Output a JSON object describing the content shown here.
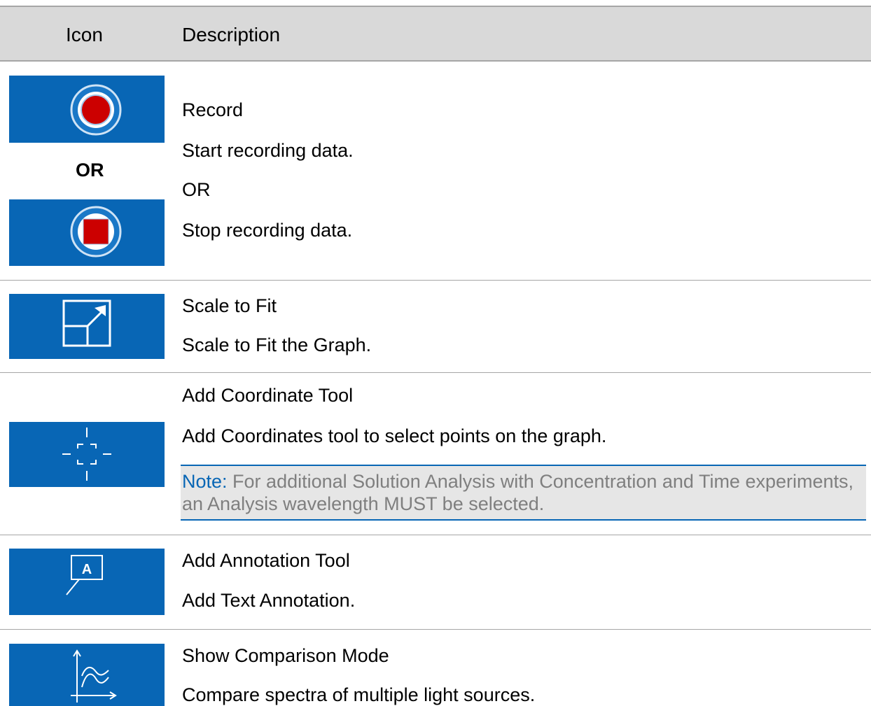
{
  "header": {
    "icon_col": "Icon",
    "desc_col": "Description"
  },
  "colors": {
    "icon_bg": "#0866b5",
    "record_red": "#cc0000",
    "header_bg": "#d9d9d9",
    "note_accent": "#0866b5"
  },
  "rows": [
    {
      "icons": [
        "record-icon",
        "stop-icon"
      ],
      "icon_separator": "OR",
      "title": "Record",
      "lines": [
        "Start recording data.",
        "OR",
        "Stop recording data."
      ]
    },
    {
      "icons": [
        "scale-to-fit-icon"
      ],
      "title": "Scale to Fit",
      "lines": [
        "Scale to Fit the Graph."
      ]
    },
    {
      "icons": [
        "coordinate-tool-icon"
      ],
      "title": "Add Coordinate Tool",
      "lines": [
        "Add Coordinates tool to select points on the graph."
      ],
      "note": {
        "label": "Note:",
        "text": " For additional Solution Analysis with Concentration and Time experiments, an Analysis wavelength MUST be selected."
      }
    },
    {
      "icons": [
        "annotation-tool-icon"
      ],
      "title": "Add Annotation Tool",
      "lines": [
        "Add Text Annotation."
      ],
      "icon_letter": "A"
    },
    {
      "icons": [
        "comparison-mode-icon"
      ],
      "title": "Show Comparison Mode",
      "lines": [
        "Compare spectra of multiple light sources."
      ]
    }
  ]
}
